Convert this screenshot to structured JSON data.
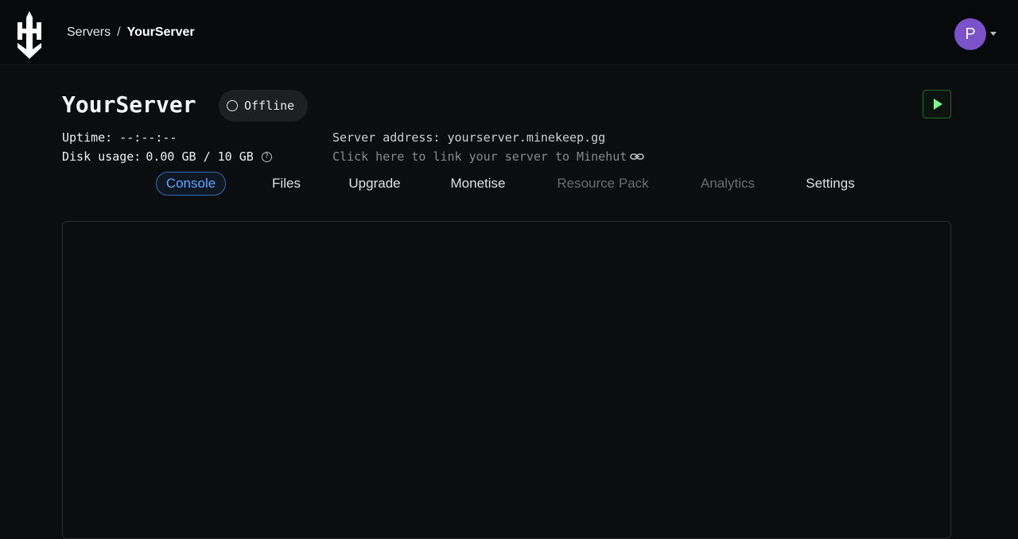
{
  "header": {
    "breadcrumb": [
      "Servers",
      "/",
      "YourServer"
    ],
    "avatar_initial": "P"
  },
  "server": {
    "name": "YourServer",
    "status": "Offline",
    "uptime_label": "Uptime: --:--:--",
    "disk_label": "Disk usage:",
    "disk_value": "0.00 GB / 10 GB",
    "address": "Server address: yourserver.minekeep.gg",
    "link_text": "Click here to link your server to Minehut"
  },
  "tabs": [
    {
      "label": "Console",
      "state": "active"
    },
    {
      "label": "Files",
      "state": "normal"
    },
    {
      "label": "Upgrade",
      "state": "normal"
    },
    {
      "label": "Monetise",
      "state": "normal"
    },
    {
      "label": "Resource Pack",
      "state": "disabled"
    },
    {
      "label": "Analytics",
      "state": "disabled"
    },
    {
      "label": "Settings",
      "state": "normal"
    }
  ],
  "colors": {
    "accent": "#5aa6ff",
    "start_button": "#7ff58c",
    "avatar": "#7b52c9"
  },
  "icons": {
    "logo": "sword-logo-icon",
    "status": "circle-status-icon",
    "play": "play-icon",
    "help": "help-circle-icon",
    "link": "link-icon",
    "avatar_menu": "caret-down-icon"
  }
}
